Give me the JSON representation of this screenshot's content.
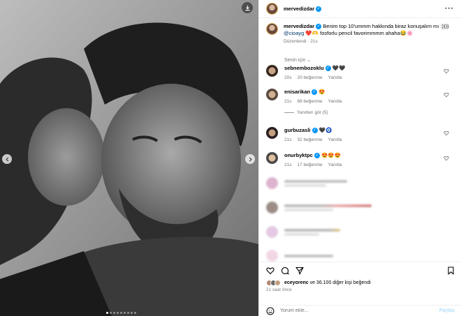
{
  "post": {
    "author": "mervedizdar",
    "caption_text": "Benim top 10'ummm hakkında biraz konuşalım mı :))))",
    "caption_mention": "@cioayg",
    "caption_rest": "❤️🫶 fosforlu pencil favorimmmm ahaha😂🌸",
    "caption_meta": "Düzenlendi · 21s",
    "filter_label": "Senin için ⌄",
    "likes_text": "ve 36.100 diğer kişi beğendi",
    "likes_user": "eceyorenc",
    "posted_ago": "21 saat önce",
    "comment_placeholder": "Yorum ekle...",
    "post_button": "Paylaş"
  },
  "comments": [
    {
      "user": "sebnembozoklu",
      "text": "🖤🖤",
      "ago": "20s",
      "likes": "20 beğenme",
      "reply": "Yanıtla"
    },
    {
      "user": "enisarikan",
      "text": "😍",
      "ago": "21s",
      "likes": "68 beğenme",
      "reply": "Yanıtla",
      "replies": "Yanıtları gör (5)"
    },
    {
      "user": "gurbuzasli",
      "text": "🖤🧿",
      "ago": "21s",
      "likes": "32 beğenme",
      "reply": "Yanıtla"
    },
    {
      "user": "onurbyktpc",
      "text": "😍😍😍",
      "ago": "21s",
      "likes": "17 beğenme",
      "reply": "Yanıtla"
    }
  ],
  "colors": {
    "accent": "#0095f6",
    "muted": "#737373",
    "link": "#00376b",
    "heart": "#ed4956"
  },
  "carousel": {
    "total": 9,
    "active": 1
  }
}
